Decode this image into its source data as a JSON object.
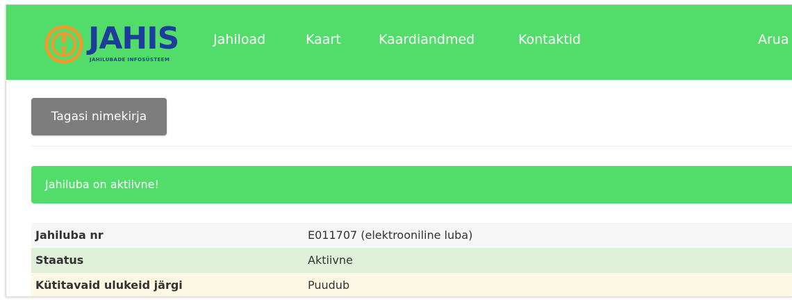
{
  "brand": {
    "name": "JAHIS",
    "subtitle": "JAHILUBADE INFOSÜSTEEM",
    "colors": {
      "navbar": "#52dc6a",
      "logo_blue": "#1c3d9a",
      "logo_orange": "#f2992e"
    }
  },
  "nav": {
    "items": [
      "Jahiload",
      "Kaart",
      "Kaardiandmed",
      "Kontaktid",
      "Arua"
    ]
  },
  "back_button": {
    "label": "Tagasi nimekirja"
  },
  "alert": {
    "text": "Jahiluba on aktiivne!",
    "color": "#52dc6a"
  },
  "details": {
    "rows": [
      {
        "label": "Jahiluba nr",
        "value": "E011707 (elektrooniline luba)"
      },
      {
        "label": "Staatus",
        "value": "Aktiivne"
      },
      {
        "label": "Kütitavaid ulukeid järgi",
        "value": "Puudub"
      }
    ]
  }
}
